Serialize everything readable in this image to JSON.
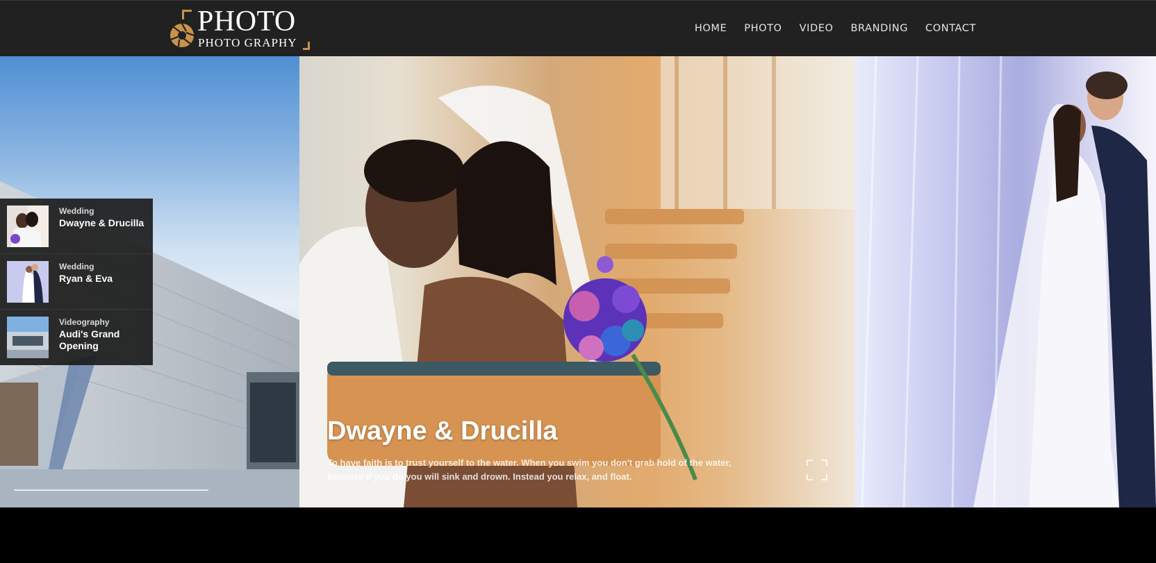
{
  "brand": {
    "title": "PHOTO",
    "subtitle": "PHOTO GRAPHY",
    "accent_color": "#c8924a"
  },
  "nav": {
    "items": [
      {
        "label": "HOME"
      },
      {
        "label": "PHOTO"
      },
      {
        "label": "VIDEO"
      },
      {
        "label": "BRANDING"
      },
      {
        "label": "CONTACT"
      }
    ]
  },
  "playlist": {
    "items": [
      {
        "category": "Wedding",
        "title": "Dwayne & Drucilla",
        "thumb_icon": "wedding-couple-photo"
      },
      {
        "category": "Wedding",
        "title": "Ryan & Eva",
        "thumb_icon": "wedding-kiss-photo"
      },
      {
        "category": "Videography",
        "title": "Audi's Grand Opening",
        "thumb_icon": "building-photo"
      }
    ]
  },
  "slider": {
    "active_title": "Dwayne & Drucilla",
    "active_text": "To have faith is to trust yourself to the water. When you swim you don't grab hold of the water, because if you do you will sink and drown. Instead you relax, and float.",
    "fullscreen_icon": "fullscreen-icon"
  },
  "colors": {
    "header_bg": "#212121",
    "page_bg": "#000000"
  }
}
